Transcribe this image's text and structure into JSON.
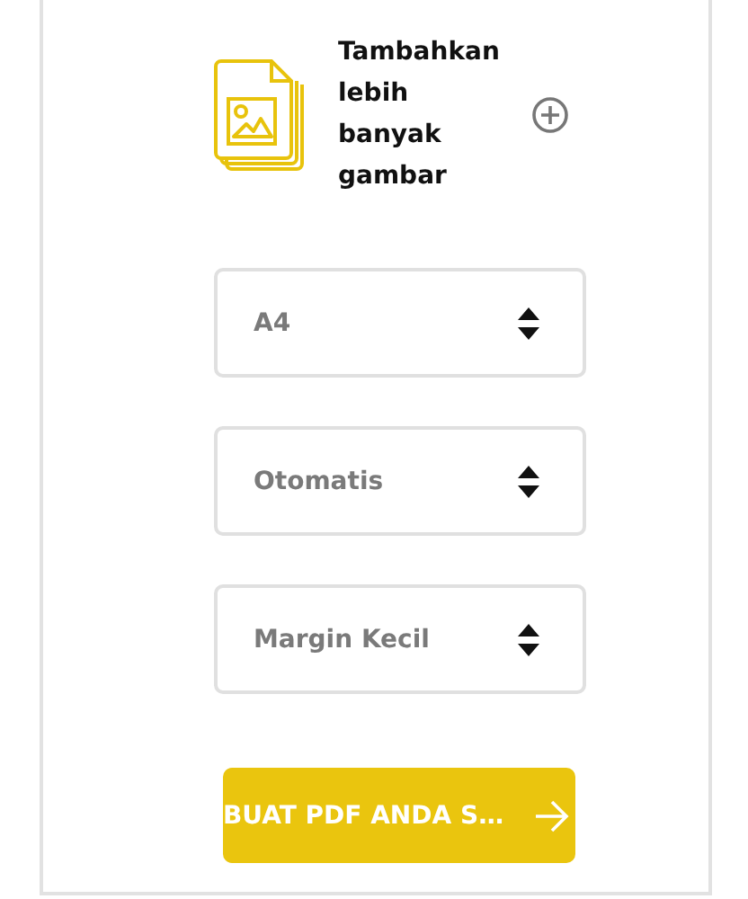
{
  "add_images": {
    "label": "Tambahkan lebih banyak gambar"
  },
  "selects": [
    {
      "value": "A4"
    },
    {
      "value": "Otomatis"
    },
    {
      "value": "Margin Kecil"
    }
  ],
  "submit_button": {
    "label": "BUAT PDF ANDA S…"
  }
}
